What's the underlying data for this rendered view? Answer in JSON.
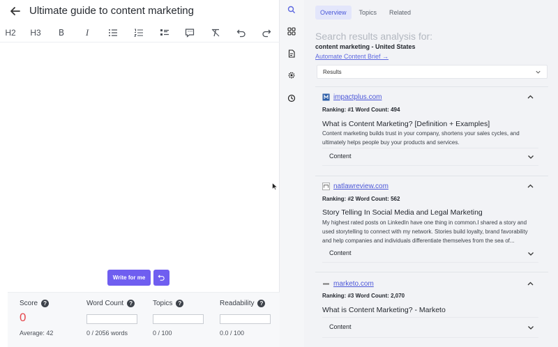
{
  "editor": {
    "title": "Ultimate guide to content marketing",
    "toolbar": {
      "h2": "H2",
      "h3": "H3",
      "bold": "B",
      "italic": "I"
    },
    "write_button": "Write for me"
  },
  "scorebar": {
    "score": {
      "label": "Score",
      "value": "0",
      "sub": "Average: 42"
    },
    "word_count": {
      "label": "Word Count",
      "sub": "0 / 2056 words"
    },
    "topics": {
      "label": "Topics",
      "sub": "0 / 100"
    },
    "readability": {
      "label": "Readability",
      "sub": "0.0 / 100"
    },
    "help_glyph": "?"
  },
  "panel": {
    "tabs": [
      "Overview",
      "Topics",
      "Related"
    ],
    "active_tab": "Overview",
    "analysis_title": "Search results analysis for:",
    "query": "content marketing - United States",
    "brief_link": "Automate Content Brief →",
    "results_select": "Results",
    "results": [
      {
        "site": "impactplus.com",
        "ranking": "Ranking: #1  Word Count: 494",
        "title": "What is Content Marketing? [Definition + Examples]",
        "description": "Content marketing builds trust in your company, shortens your sales cycles, and ultimately helps people buy your products and services.",
        "content_label": "Content"
      },
      {
        "site": "natlawreview.com",
        "ranking": "Ranking: #2  Word Count: 562",
        "title": "Story Telling In Social Media and Legal Marketing",
        "description": "My highest rated posts on LinkedIn have one thing in common.I shared a story and used storytelling to connect with my network. Stories build loyalty, brand favorability and help companies and individuals differentiate themselves from the sea of...",
        "content_label": "Content"
      },
      {
        "site": "marketo.com",
        "ranking": "Ranking: #3  Word Count: 2,070",
        "title": "What is Content Marketing? - Marketo",
        "description": "",
        "content_label": "Content"
      }
    ]
  },
  "colors": {
    "accent": "#6f5ef0",
    "link": "#4b56d8",
    "score": "#e5484d",
    "panel_bg": "#f2f3f6"
  },
  "icons": {
    "back": "arrow-left-icon",
    "rail": [
      "search-icon",
      "grid-icon",
      "document-icon",
      "settings-icon",
      "history-icon"
    ]
  }
}
